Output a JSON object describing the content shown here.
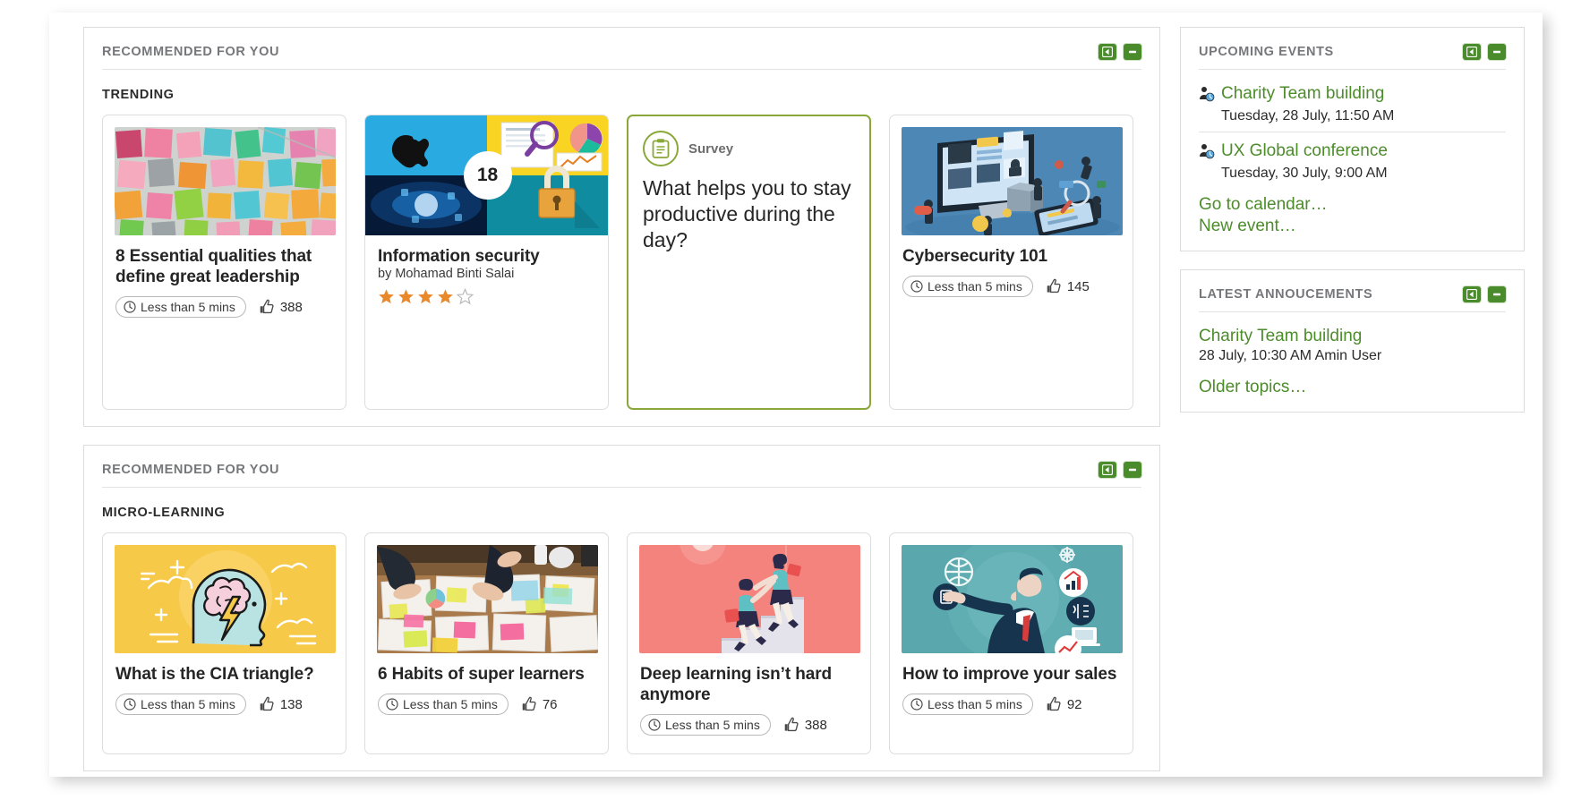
{
  "icons": {
    "collapse_left": "collapse-left-icon",
    "minimize": "minimize-icon",
    "clock": "clock-icon",
    "thumbs_up": "thumbs-up-icon",
    "clipboard": "clipboard-icon",
    "event": "event-person-clock-icon",
    "star_filled": "star-filled-icon",
    "star_empty": "star-empty-icon"
  },
  "colors": {
    "accent_green": "#4c8c2b",
    "tool_green": "#4a8b2c",
    "survey_border": "#8aa83a",
    "star_orange": "#e8892b",
    "heading_gray": "#76777a",
    "text_dark": "#252525"
  },
  "panels": {
    "trending": {
      "title": "RECOMMENDED FOR YOU",
      "section": "TRENDING",
      "cards": [
        {
          "type": "article",
          "title": "8 Essential qualities that define great leadership",
          "duration": "Less than 5 mins",
          "likes": "388",
          "thumb": "sticky-notes-wall"
        },
        {
          "type": "course",
          "title": "Information security",
          "author": "by Mohamad Binti Salai",
          "badge": "18",
          "rating": 4,
          "rating_max": 5,
          "thumb": "security-collage"
        },
        {
          "type": "survey",
          "label": "Survey",
          "question": "What helps you to stay productive during the day?"
        },
        {
          "type": "article",
          "title": "Cybersecurity 101",
          "duration": "Less than 5 mins",
          "likes": "145",
          "thumb": "cybersecurity-isometric"
        }
      ]
    },
    "micro": {
      "title": "RECOMMENDED FOR YOU",
      "section": "MICRO-LEARNING",
      "cards": [
        {
          "type": "article",
          "title": "What is the CIA triangle?",
          "duration": "Less than 5 mins",
          "likes": "138",
          "thumb": "brain-head-yellow"
        },
        {
          "type": "article",
          "title": "6 Habits of super learners",
          "duration": "Less than 5 mins",
          "likes": "76",
          "thumb": "desk-papers-photo"
        },
        {
          "type": "article",
          "title": "Deep learning isn’t hard anymore",
          "duration": "Less than 5 mins",
          "likes": "388",
          "thumb": "stairs-help-pink"
        },
        {
          "type": "article",
          "title": "How to improve your sales",
          "duration": "Less than 5 mins",
          "likes": "92",
          "thumb": "businessman-teal"
        }
      ]
    },
    "events": {
      "title": "UPCOMING EVENTS",
      "items": [
        {
          "name": "Charity Team building",
          "when": "Tuesday, 28 July, 11:50 AM"
        },
        {
          "name": "UX Global conference",
          "when": "Tuesday, 30 July, 9:00 AM"
        }
      ],
      "actions": [
        "Go to calendar…",
        "New event…"
      ]
    },
    "announcements": {
      "title": "LATEST ANNOUCEMENTS",
      "items": [
        {
          "name": "Charity Team building",
          "when": "28 July, 10:30 AM Amin User"
        }
      ],
      "actions": [
        "Older topics…"
      ]
    }
  }
}
